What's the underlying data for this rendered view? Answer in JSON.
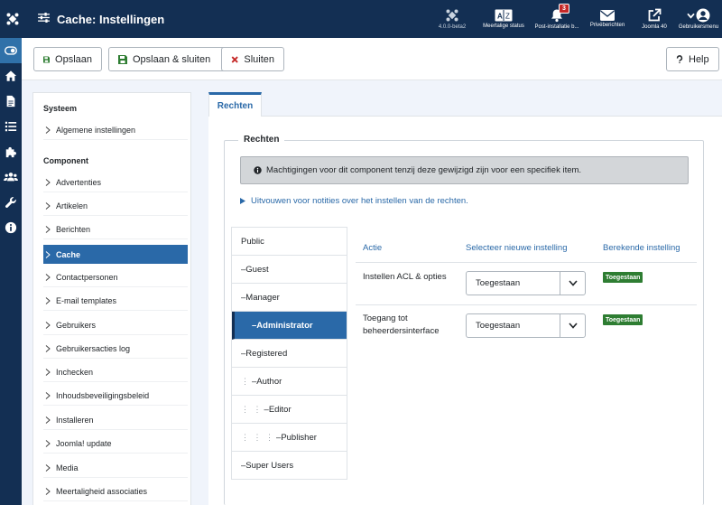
{
  "header": {
    "title": "Cache: Instellingen",
    "items": [
      {
        "label": "4.0.0-beta2",
        "icon": "joomla-logo-icon"
      },
      {
        "label": "Meertalige status",
        "icon": "language-icon"
      },
      {
        "label": "Post-installatie b...",
        "icon": "bell-icon",
        "badge": "3"
      },
      {
        "label": "Privéberichten",
        "icon": "envelope-icon"
      },
      {
        "label": "Joomla 40",
        "icon": "external-link-icon"
      },
      {
        "label": "Gebruikersmenu",
        "icon": "user-icon"
      }
    ]
  },
  "toolbar": {
    "save_label": "Opslaan",
    "save_close_label": "Opslaan & sluiten",
    "close_label": "Sluiten",
    "help_label": "Help"
  },
  "sidebar": {
    "section_system": "Systeem",
    "system_items": [
      "Algemene instellingen"
    ],
    "section_component": "Component",
    "component_items": [
      "Advertenties",
      "Artikelen",
      "Berichten",
      "Cache",
      "Contactpersonen",
      "E-mail templates",
      "Gebruikers",
      "Gebruikersacties log",
      "Inchecken",
      "Inhoudsbeveiligingsbeleid",
      "Installeren",
      "Joomla! update",
      "Media",
      "Meertaligheid associaties"
    ],
    "active_item": "Cache"
  },
  "tabs": {
    "permissions": "Rechten"
  },
  "permissions": {
    "legend": "Rechten",
    "notice": "Machtigingen voor dit component tenzij deze gewijzigd zijn voor een specifiek item.",
    "expand_link": "Uitvouwen voor notities over het instellen van de rechten.",
    "groups": [
      {
        "label": "Public",
        "prefix": "",
        "dots": ""
      },
      {
        "label": "Guest",
        "prefix": "– ",
        "dots": ""
      },
      {
        "label": "Manager",
        "prefix": "– ",
        "dots": ""
      },
      {
        "label": "Administrator",
        "prefix": "– ",
        "dots": ""
      },
      {
        "label": "Registered",
        "prefix": "– ",
        "dots": ""
      },
      {
        "label": "Author",
        "prefix": "– ",
        "dots": "⋮"
      },
      {
        "label": "Editor",
        "prefix": "– ",
        "dots": "⋮ ⋮"
      },
      {
        "label": "Publisher",
        "prefix": "– ",
        "dots": "⋮ ⋮ ⋮"
      },
      {
        "label": "Super Users",
        "prefix": "– ",
        "dots": ""
      }
    ],
    "active_group": "Administrator",
    "columns": {
      "action": "Actie",
      "select": "Selecteer nieuwe instelling",
      "computed": "Berekende instelling"
    },
    "rows": [
      {
        "action": "Instellen ACL & opties",
        "select": "Toegestaan",
        "computed": "Toegestaan"
      },
      {
        "action": "Toegang tot beheerdersinterface",
        "select": "Toegestaan",
        "computed": "Toegestaan"
      }
    ]
  },
  "colors": {
    "header_bg": "#132f53",
    "accent": "#2a69a8",
    "success": "#2e7d32"
  }
}
